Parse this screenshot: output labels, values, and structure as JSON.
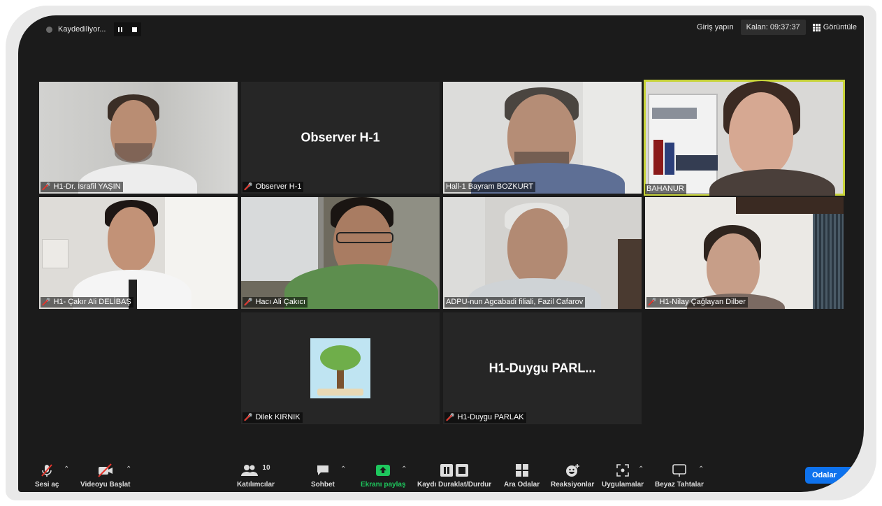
{
  "recording": {
    "status": "Kaydediliyor..."
  },
  "topbar": {
    "signin": "Giriş yapın",
    "remaining": "Kalan: 09:37:37",
    "view": "Görüntüle"
  },
  "tiles": [
    {
      "name": "H1-Dr. İsrafil YAŞIN",
      "muted": true
    },
    {
      "name": "Observer H-1",
      "muted": true,
      "display_name": "Observer H-1"
    },
    {
      "name": "Hall-1 Bayram BOZKURT",
      "muted": false
    },
    {
      "name": "BAHANUR",
      "muted": false,
      "active_speaker": true
    },
    {
      "name": "H1- Çakır Ali DELİBAŞ",
      "muted": true
    },
    {
      "name": "Hacı Ali Çakıcı",
      "muted": true
    },
    {
      "name": "ADPU-nun Agcabadi filiali, Fazil Cafarov",
      "muted": false
    },
    {
      "name": "H1-Nilay Çağlayan Dilber",
      "muted": true
    },
    {
      "name": "Dilek KIRNIK",
      "muted": true
    },
    {
      "name": "H1-Duygu PARLAK",
      "muted": true,
      "display_name": "H1-Duygu  PARL..."
    }
  ],
  "toolbar": {
    "mute": "Sesi aç",
    "video": "Videoyu Başlat",
    "participants": "Katılımcılar",
    "participants_count": "10",
    "chat": "Sohbet",
    "share": "Ekranı paylaş",
    "record": "Kaydı Duraklat/Durdur",
    "breakout": "Ara Odalar",
    "reactions": "Reaksiyonlar",
    "apps": "Uygulamalar",
    "whiteboard": "Beyaz Tahtalar",
    "rooms_button": "Odalar"
  },
  "colors": {
    "active_border": "#c7d33a",
    "share_green": "#1ec75d",
    "mute_red": "#e5362c",
    "odalar_blue": "#0e72ed"
  }
}
